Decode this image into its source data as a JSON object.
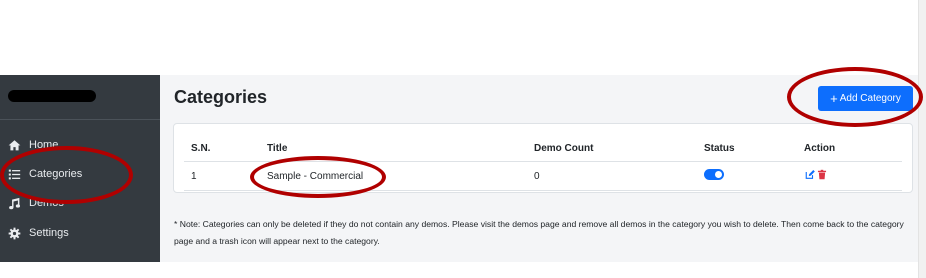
{
  "sidebar": {
    "items": [
      {
        "label": "Home",
        "icon": "home-icon"
      },
      {
        "label": "Categories",
        "icon": "list-icon"
      },
      {
        "label": "Demos",
        "icon": "music-icon"
      },
      {
        "label": "Settings",
        "icon": "gear-icon"
      }
    ]
  },
  "header": {
    "title": "Categories",
    "add_button": {
      "plus": "+",
      "label": "Add Category"
    }
  },
  "table": {
    "columns": [
      "S.N.",
      "Title",
      "Demo Count",
      "Status",
      "Action"
    ],
    "rows": [
      {
        "sn": "1",
        "title": "Sample - Commercial",
        "demo_count": "0",
        "status_enabled": true
      }
    ]
  },
  "note": "* Note: Categories can only be deleted if they do not contain any demos. Please visit the demos page and remove all demos in the category you wish to delete. Then come back to the category page and a trash icon will appear next to the category.",
  "colors": {
    "sidebar_bg": "#343a40",
    "primary": "#0d6efd",
    "danger": "#dc3545",
    "annotation": "#b00000"
  }
}
